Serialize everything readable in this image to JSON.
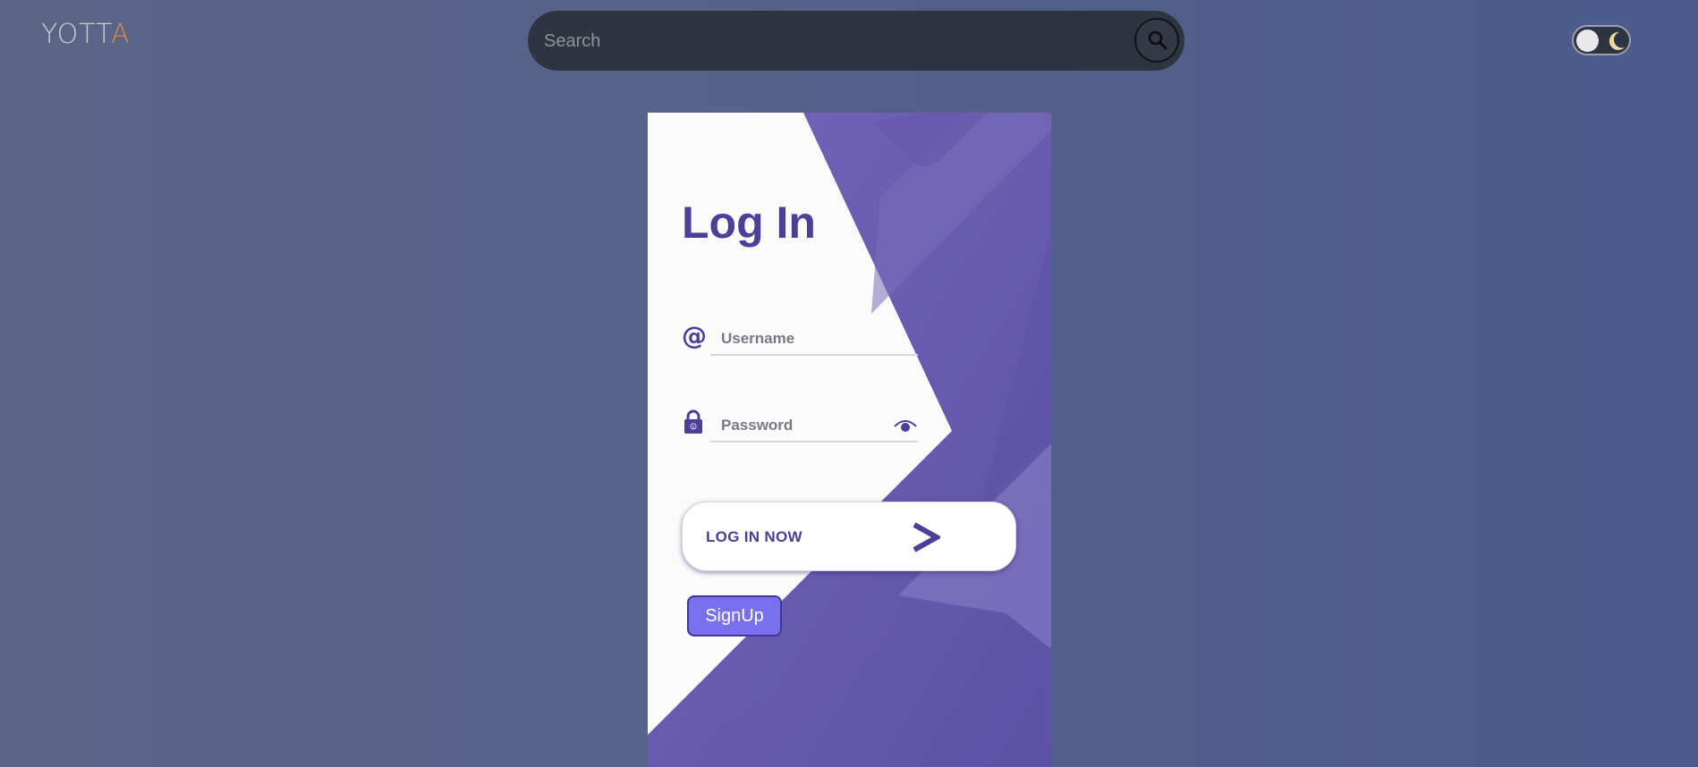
{
  "header": {
    "logo_text_main": "YOTT",
    "logo_text_accent": "A",
    "search": {
      "placeholder": "Search",
      "value": ""
    },
    "search_button_icon": "search-icon",
    "theme_toggle": {
      "state": "light",
      "icon": "moon-icon"
    }
  },
  "login_card": {
    "title": "Log In",
    "username": {
      "icon": "at-icon",
      "placeholder": "Username",
      "value": ""
    },
    "password": {
      "icon": "lock-icon",
      "placeholder": "Password",
      "value": "",
      "toggle_icon": "eye-icon"
    },
    "login_button": {
      "label": "LOG IN NOW",
      "icon": "chevron-right-icon"
    },
    "signup_button": {
      "label": "SignUp"
    }
  },
  "colors": {
    "page_background": "#55618a",
    "search_bar": "#2f3441",
    "card_background": "#fbfbfb",
    "accent_purple": "#4b3f98",
    "decor_purple": "#6a5db0",
    "signup_background": "#7a6fec",
    "logo_accent": "#d18a55"
  }
}
